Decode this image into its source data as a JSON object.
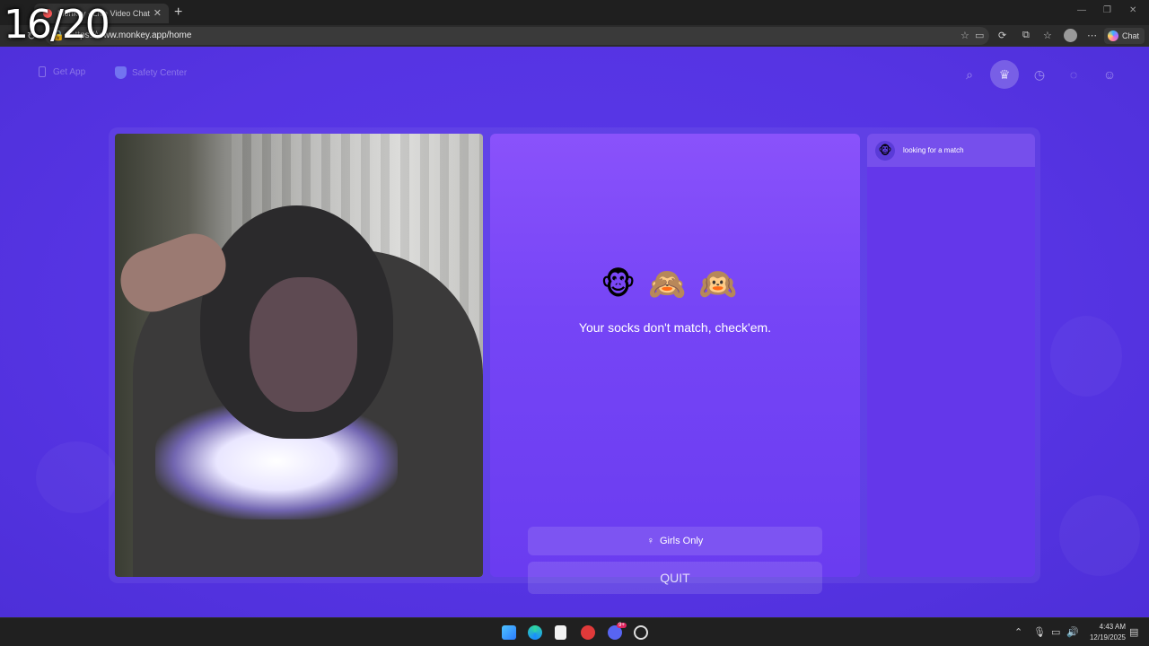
{
  "browser": {
    "tab_title": "Monkey - Live Video Chat",
    "url": "https://www.monkey.app/home",
    "chat_button_label": "Chat",
    "new_tab_glyph": "+"
  },
  "overlay": {
    "counter": "16/20"
  },
  "topnav": {
    "get_app_label": "Get App",
    "safety_center_label": "Safety Center",
    "right_icons": [
      "search-icon",
      "crown-icon",
      "history-icon",
      "chat-icon",
      "profile-icon"
    ]
  },
  "status_panel": {
    "emojis": "🐵🙈🙉",
    "message": "Your socks don't match, check'em.",
    "girls_only_icon": "♀",
    "girls_only_label": "Girls Only",
    "quit_label": "QUIT"
  },
  "chat_panel": {
    "avatar_emoji": "🐵",
    "status_text": "looking for a match"
  },
  "taskbar": {
    "time": "4:43 AM",
    "date": "12/19/2025",
    "discord_badge": "9+"
  },
  "colors": {
    "page_bg": "#5634e3",
    "status_panel_top": "#8a52fb",
    "chat_panel": "#6437ea",
    "browser_chrome": "#2b2b2b"
  }
}
